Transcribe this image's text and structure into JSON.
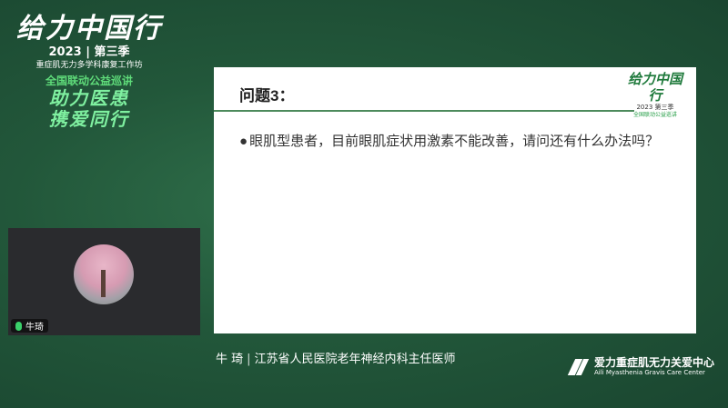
{
  "campaign": {
    "title": "给力中国行",
    "year_season": "2023 | 第三季",
    "subtitle": "重症肌无力多学科康复工作坊",
    "tour": "全国联动公益巡讲",
    "slogan_line1": "助力医患",
    "slogan_line2": "携爱同行"
  },
  "video": {
    "participant_name": "牛琦"
  },
  "slide": {
    "heading": "问题3：",
    "bullet": "●",
    "question": "眼肌型患者，目前眼肌症状用激素不能改善，请问还有什么办法吗？",
    "logo_title": "给力中国行",
    "logo_year": "2023 第三季",
    "logo_tour": "全国联动公益巡讲"
  },
  "caption": {
    "name": "牛 琦",
    "separator": "|",
    "affiliation": "江苏省人民医院老年神经内科主任医师"
  },
  "organization": {
    "name_cn": "爱力重症肌无力关爱中心",
    "name_en": "Aili Myasthenia Gravis Care Center"
  }
}
